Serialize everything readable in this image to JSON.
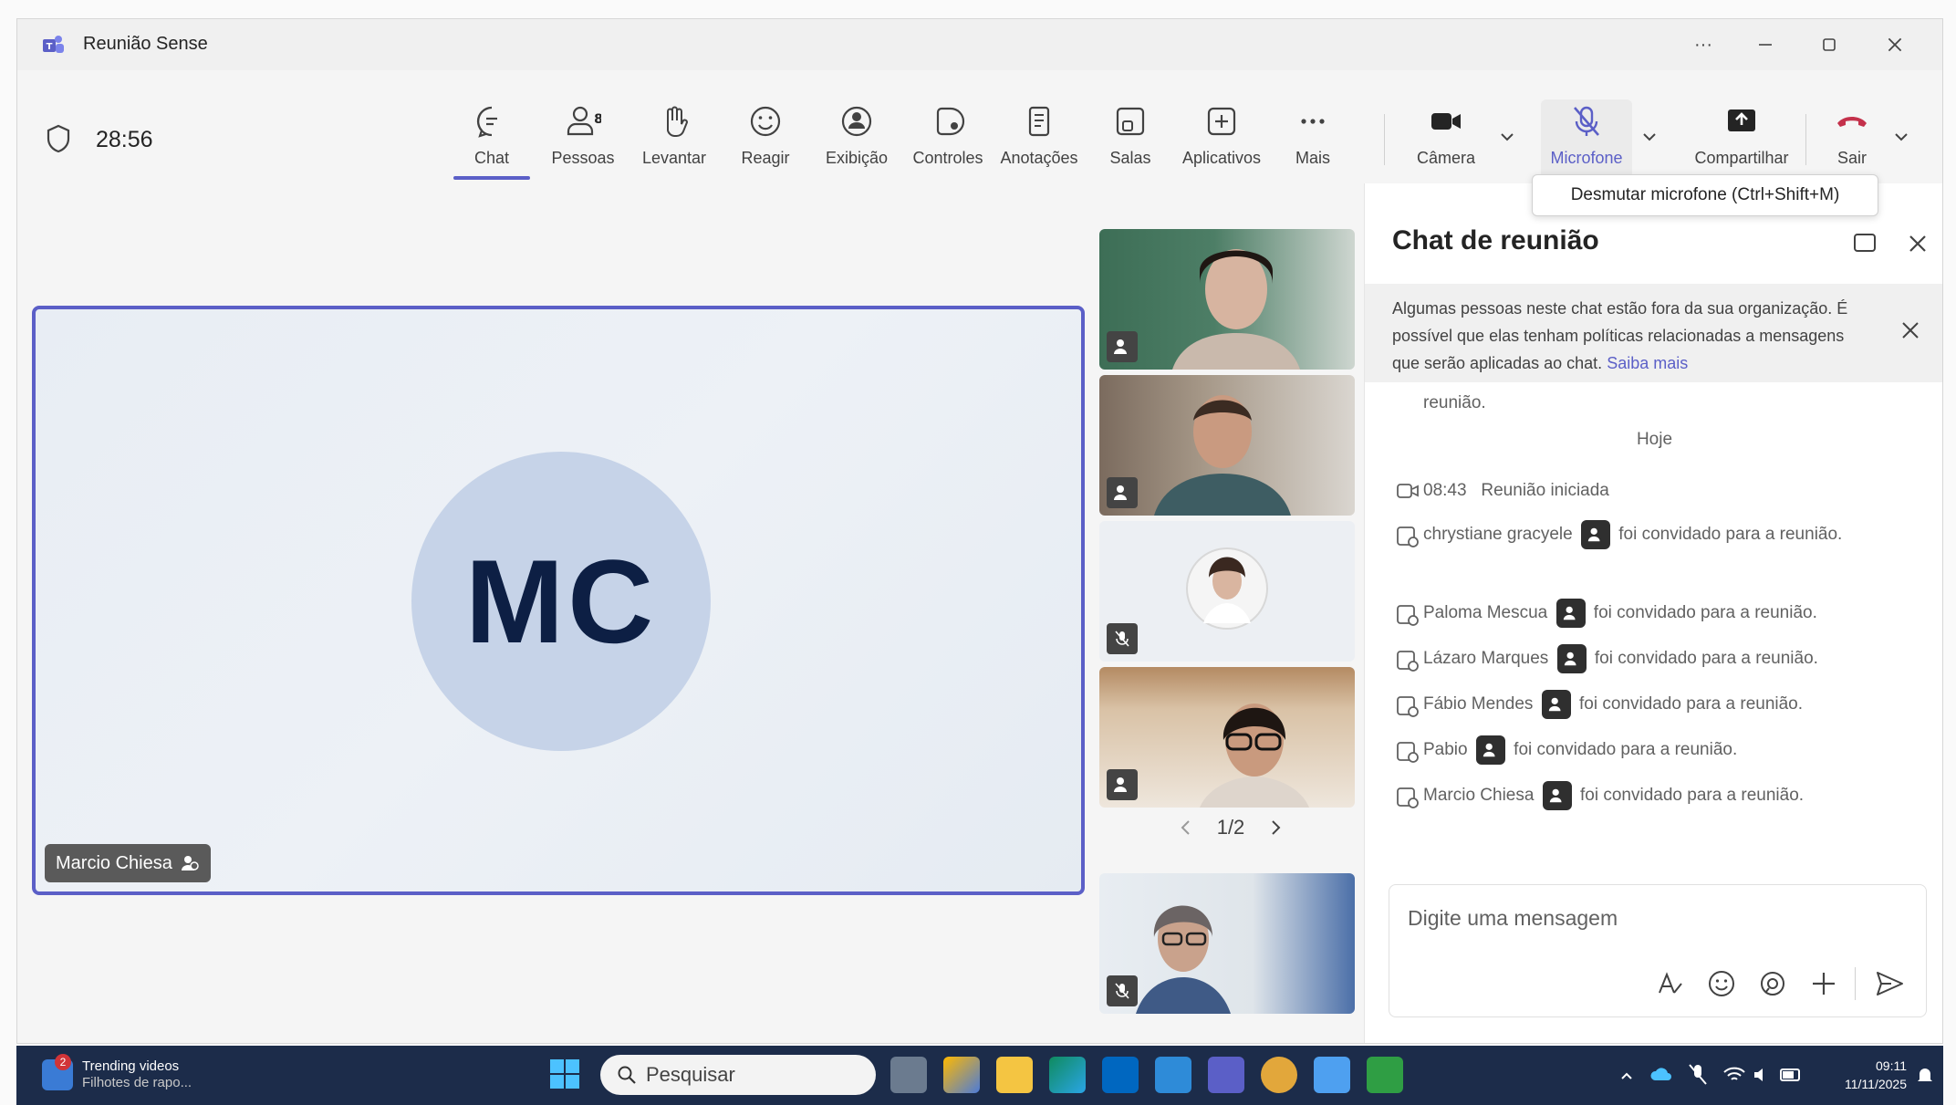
{
  "window": {
    "title": "Reunião Sense",
    "more_label": "···"
  },
  "meeting": {
    "timer": "28:56"
  },
  "toolbar": {
    "items": [
      {
        "label": "Chat"
      },
      {
        "label": "Pessoas",
        "badge": "8"
      },
      {
        "label": "Levantar"
      },
      {
        "label": "Reagir"
      },
      {
        "label": "Exibição"
      },
      {
        "label": "Controles"
      },
      {
        "label": "Anotações"
      },
      {
        "label": "Salas"
      },
      {
        "label": "Aplicativos"
      },
      {
        "label": "Mais"
      }
    ],
    "camera_label": "Câmera",
    "mic_label": "Microfone",
    "share_label": "Compartilhar",
    "leave_label": "Sair"
  },
  "tooltip": {
    "text": "Desmutar microfone (Ctrl+Shift+M)"
  },
  "stage": {
    "main_initials": "MC",
    "main_name": "Marcio Chiesa",
    "pager": "1/2"
  },
  "chat": {
    "title": "Chat de reunião",
    "banner_text": "Algumas pessoas neste chat estão fora da sua organização. É possível que elas tenham políticas relacionadas a mensagens que serão aplicadas ao chat.",
    "banner_link": "Saiba mais",
    "prev_tail": "reunião.",
    "day_separator": "Hoje",
    "meeting_started": {
      "time": "08:43",
      "text": "Reunião iniciada"
    },
    "invite_suffix": "foi convidado para a reunião.",
    "invites": [
      {
        "name": "chrystiane gracyele"
      },
      {
        "name": "Paloma Mescua"
      },
      {
        "name": "Lázaro Marques"
      },
      {
        "name": "Fábio Mendes"
      },
      {
        "name": "Pabio"
      },
      {
        "name": "Marcio Chiesa"
      }
    ],
    "compose_placeholder": "Digite uma mensagem"
  },
  "taskbar": {
    "news_title": "Trending videos",
    "news_sub": "Filhotes de rapo...",
    "news_badge": "2",
    "search_placeholder": "Pesquisar",
    "clock_time": "09:11",
    "clock_date": "11/11/2025"
  },
  "colors": {
    "accent": "#5b5fc7",
    "leave": "#c4314b",
    "taskbar": "#1c2c4a"
  }
}
